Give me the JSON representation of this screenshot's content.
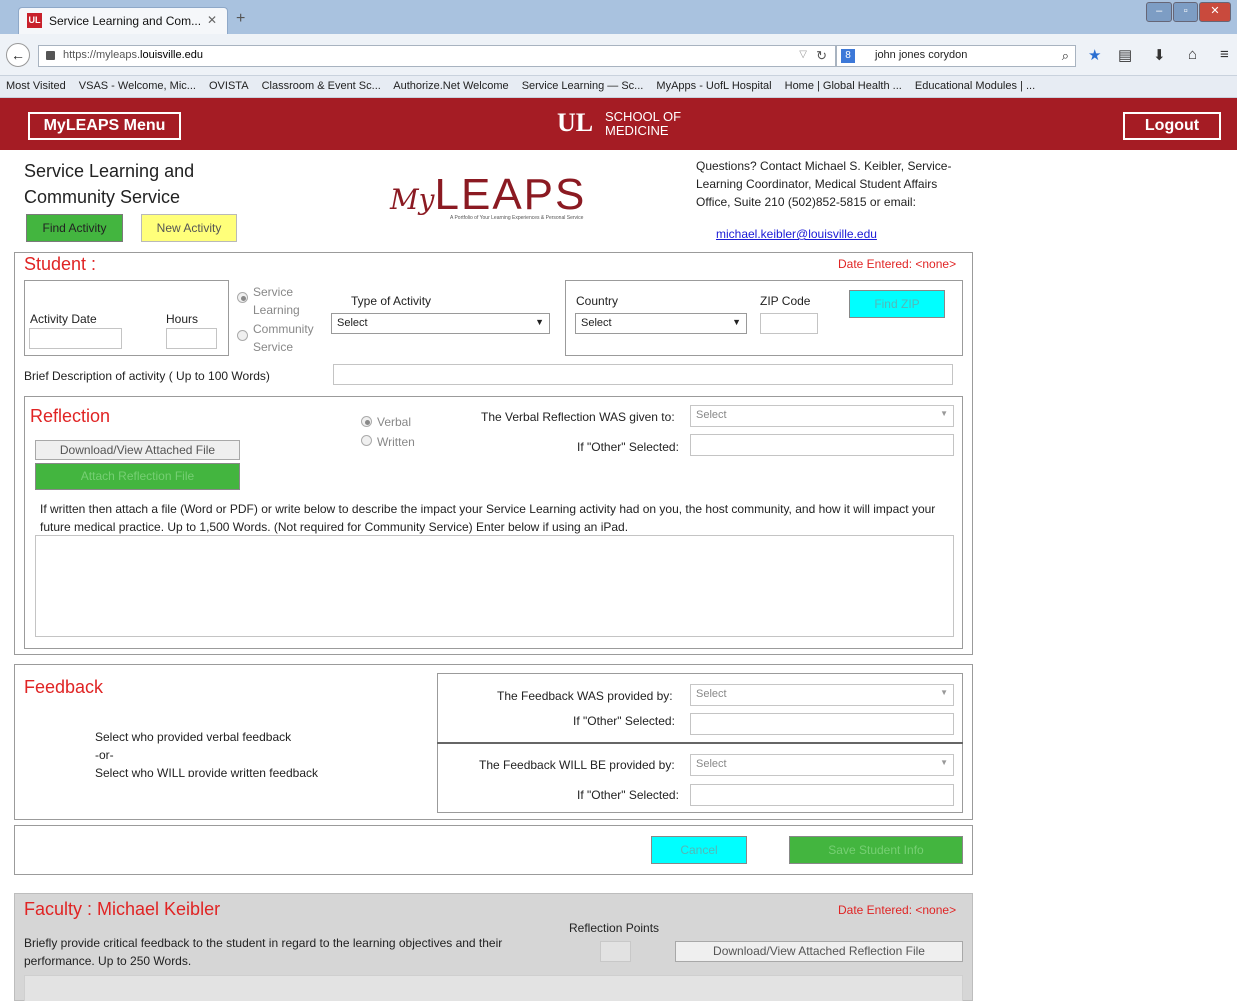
{
  "browser": {
    "tab_title": "Service Learning and Com...",
    "url_prefix": "https://myleaps.",
    "url_domain": "louisville.edu",
    "search_text": "john jones corydon",
    "bookmarks": [
      "Most Visited",
      "VSAS - Welcome, Mic...",
      "OVISTA",
      "Classroom & Event Sc...",
      "Authorize.Net Welcome",
      "Service Learning — Sc...",
      "MyApps - UofL Hospital",
      "Home | Global Health ...",
      "Educational Modules | ..."
    ]
  },
  "appbar": {
    "menu_label": "MyLEAPS Menu",
    "logout_label": "Logout",
    "logo_mark": "UL",
    "school_line1": "SCHOOL OF",
    "school_line2": "MEDICINE",
    "color": "#a51c24"
  },
  "header": {
    "title_line1": "Service Learning and",
    "title_line2": "Community Service",
    "find_label": "Find Activity",
    "new_label": "New Activity",
    "logo_my": "My",
    "logo_leaps": "LEAPS",
    "logo_tagline": "A Portfolio of Your Learning Experiences & Personal Service",
    "contact_text": "Questions? Contact Michael S. Keibler, Service-Learning Coordinator, Medical Student Affairs Office, Suite 210 (502)852-5815 or email:",
    "contact_email": "michael.keibler@louisville.edu"
  },
  "student": {
    "title": "Student :",
    "date_entered": "Date Entered: <none>",
    "activity_date_label": "Activity Date",
    "hours_label": "Hours",
    "radio_service": "Service Learning",
    "radio_community": "Community Service",
    "type_label": "Type of Activity",
    "type_value": "Select",
    "country_label": "Country",
    "country_value": "Select",
    "zip_label": "ZIP Code",
    "find_zip_label": "Find ZIP",
    "brief_label": "Brief Description of activity ( Up to 100 Words)"
  },
  "reflection": {
    "title": "Reflection",
    "download_label": "Download/View Attached File",
    "attach_label": "Attach Reflection File",
    "radio_verbal": "Verbal",
    "radio_written": "Written",
    "given_to_label": "The Verbal Reflection WAS given to:",
    "given_to_value": "Select",
    "other_label": "If \"Other\" Selected:",
    "instructions": "If written then attach a file (Word or PDF) or write below to describe the impact your Service Learning activity had on you, the host community, and how it will impact your future medical practice. Up to 1,500 Words. (Not required for Community Service) Enter below if using an iPad."
  },
  "feedback": {
    "title": "Feedback",
    "hint_line1": "Select who provided verbal feedback",
    "hint_line2": "-or-",
    "hint_line3": "Select who WILL provide written feedback",
    "was_label": "The Feedback WAS provided by:",
    "was_value": "Select",
    "will_label": "The Feedback WILL BE provided by:",
    "will_value": "Select",
    "other_label": "If \"Other\" Selected:"
  },
  "actions": {
    "cancel_label": "Cancel",
    "save_label": "Save Student Info"
  },
  "faculty": {
    "title": "Faculty : Michael Keibler",
    "date_entered": "Date Entered: <none>",
    "points_label": "Reflection Points",
    "instructions": "Briefly provide critical feedback to the student in regard to the learning objectives and their performance. Up to 250 Words.",
    "download_label": "Download/View Attached Reflection File"
  }
}
